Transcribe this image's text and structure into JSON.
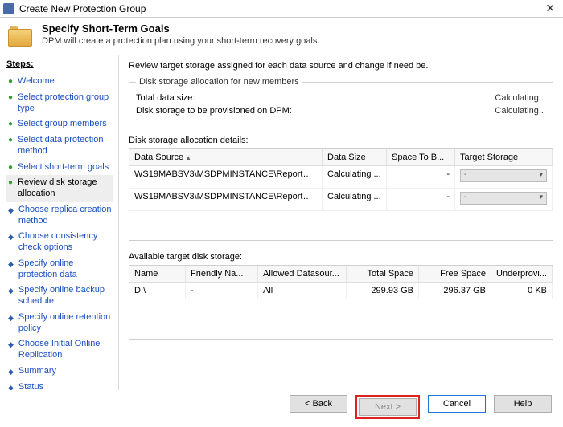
{
  "window": {
    "title": "Create New Protection Group"
  },
  "header": {
    "title": "Specify Short-Term Goals",
    "subtitle": "DPM will create a protection plan using your short-term recovery goals."
  },
  "steps_label": "Steps:",
  "steps": [
    {
      "label": "Welcome",
      "state": "done"
    },
    {
      "label": "Select protection group type",
      "state": "done"
    },
    {
      "label": "Select group members",
      "state": "done"
    },
    {
      "label": "Select data protection method",
      "state": "done"
    },
    {
      "label": "Select short-term goals",
      "state": "done"
    },
    {
      "label": "Review disk storage allocation",
      "state": "current"
    },
    {
      "label": "Choose replica creation method",
      "state": "pending"
    },
    {
      "label": "Choose consistency check options",
      "state": "pending"
    },
    {
      "label": "Specify online protection data",
      "state": "pending"
    },
    {
      "label": "Specify online backup schedule",
      "state": "pending"
    },
    {
      "label": "Specify online retention policy",
      "state": "pending"
    },
    {
      "label": "Choose Initial Online Replication",
      "state": "pending"
    },
    {
      "label": "Summary",
      "state": "pending"
    },
    {
      "label": "Status",
      "state": "pending"
    }
  ],
  "instruction": "Review target storage assigned for each data source and change if need be.",
  "alloc_box": {
    "legend": "Disk storage allocation for new members",
    "total_label": "Total data size:",
    "total_value": "Calculating...",
    "prov_label": "Disk storage to be provisioned on DPM:",
    "prov_value": "Calculating..."
  },
  "alloc_details": {
    "label": "Disk storage allocation details:",
    "columns": {
      "c1": "Data Source",
      "c2": "Data Size",
      "c3": "Space To B...",
      "c4": "Target Storage"
    },
    "rows": [
      {
        "source": "WS19MABSV3\\MSDPMINSTANCE\\ReportServe...",
        "size": "Calculating ...",
        "space": "-",
        "target": "-"
      },
      {
        "source": "WS19MABSV3\\MSDPMINSTANCE\\ReportServe...",
        "size": "Calculating ...",
        "space": "-",
        "target": "-"
      }
    ]
  },
  "storage": {
    "label": "Available target disk storage:",
    "columns": {
      "s1": "Name",
      "s2": "Friendly Na...",
      "s3": "Allowed Datasour...",
      "s4": "Total Space",
      "s5": "Free Space",
      "s6": "Underprovi..."
    },
    "rows": [
      {
        "name": "D:\\",
        "friendly": "-",
        "allowed": "All",
        "total": "299.93 GB",
        "free": "296.37 GB",
        "under": "0 KB"
      }
    ]
  },
  "buttons": {
    "back": "< Back",
    "next": "Next >",
    "cancel": "Cancel",
    "help": "Help"
  }
}
